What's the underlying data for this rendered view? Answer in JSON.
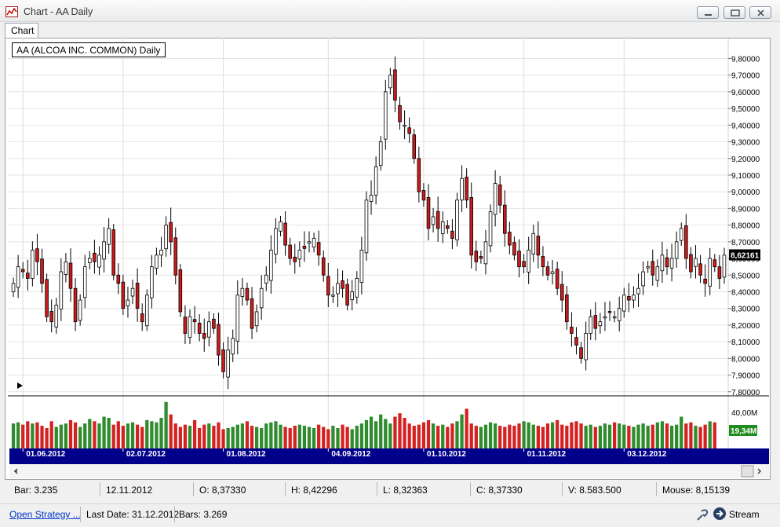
{
  "window": {
    "title": "Chart - AA Daily"
  },
  "tabs": [
    {
      "label": "Chart"
    }
  ],
  "legend": {
    "label": "AA (ALCOA INC. COMMON) Daily"
  },
  "current_price": "8,62161",
  "current_volume": "19,34M",
  "chart_data": {
    "type": "candlestick",
    "symbol": "AA (ALCOA INC. COMMON) Daily",
    "y_tick_labels": [
      "9,80000",
      "9,70000",
      "9,60000",
      "9,50000",
      "9,40000",
      "9,30000",
      "9,20000",
      "9,10000",
      "9,00000",
      "8,90000",
      "8,80000",
      "8,70000",
      "8,60000",
      "8,50000",
      "8,40000",
      "8,30000",
      "8,20000",
      "8,10000",
      "8,00000",
      "7,90000",
      "7,80000"
    ],
    "ylim": [
      7.78,
      9.84
    ],
    "volume_tick_label": "40,00M",
    "x_tick_labels": [
      "01.06.2012",
      "02.07.2012",
      "01.08.2012",
      "04.09.2012",
      "01.10.2012",
      "01.11.2012",
      "03.12.2012"
    ],
    "grid": true,
    "close": [
      8.45,
      8.55,
      8.52,
      8.48,
      8.65,
      8.58,
      8.45,
      8.25,
      8.22,
      8.32,
      8.52,
      8.58,
      8.42,
      8.22,
      8.35,
      8.55,
      8.6,
      8.58,
      8.62,
      8.7,
      8.78,
      8.5,
      8.45,
      8.3,
      8.35,
      8.42,
      8.3,
      8.22,
      8.38,
      8.55,
      8.62,
      8.65,
      8.8,
      8.7,
      8.5,
      8.28,
      8.15,
      8.25,
      8.22,
      8.15,
      8.12,
      8.22,
      8.18,
      8.02,
      7.92,
      8.05,
      8.12,
      8.38,
      8.42,
      8.35,
      8.18,
      8.28,
      8.42,
      8.5,
      8.65,
      8.78,
      8.82,
      8.68,
      8.6,
      8.58,
      8.65,
      8.66,
      8.7,
      8.72,
      8.62,
      8.5,
      8.38,
      8.38,
      8.45,
      8.42,
      8.32,
      8.4,
      8.48,
      8.65,
      8.95,
      8.98,
      9.15,
      9.3,
      9.6,
      9.7,
      9.55,
      9.42,
      9.4,
      9.35,
      9.2,
      9.0,
      8.95,
      8.78,
      8.85,
      8.78,
      8.82,
      8.78,
      8.72,
      8.95,
      9.08,
      8.95,
      8.62,
      8.58,
      8.6,
      8.7,
      8.88,
      9.05,
      8.92,
      8.75,
      8.68,
      8.62,
      8.55,
      8.55,
      8.65,
      8.75,
      8.62,
      8.55,
      8.5,
      8.52,
      8.42,
      8.35,
      8.22,
      8.15,
      8.08,
      8.0,
      8.15,
      8.25,
      8.18,
      8.22,
      8.25,
      8.28,
      8.25,
      8.3,
      8.38,
      8.35,
      8.38,
      8.42,
      8.52,
      8.55,
      8.5,
      8.55,
      8.62,
      8.55,
      8.6,
      8.7,
      8.78,
      8.6,
      8.52,
      8.6,
      8.5,
      8.45,
      8.6,
      8.55,
      8.48,
      8.62
    ],
    "volume_millions": [
      22,
      23,
      21,
      24,
      22,
      23,
      20,
      18,
      24,
      19,
      21,
      22,
      25,
      23,
      19,
      22,
      26,
      24,
      22,
      28,
      27,
      21,
      24,
      20,
      22,
      23,
      21,
      19,
      25,
      24,
      23,
      27,
      41,
      30,
      22,
      19,
      21,
      20,
      25,
      18,
      21,
      22,
      20,
      23,
      17,
      18,
      19,
      21,
      22,
      24,
      20,
      19,
      18,
      22,
      23,
      24,
      21,
      19,
      18,
      20,
      21,
      20,
      19,
      18,
      21,
      19,
      17,
      20,
      18,
      21,
      19,
      17,
      20,
      22,
      25,
      28,
      24,
      30,
      26,
      22,
      28,
      31,
      27,
      22,
      20,
      21,
      23,
      25,
      22,
      20,
      21,
      19,
      22,
      24,
      30,
      35,
      22,
      20,
      19,
      21,
      23,
      22,
      20,
      19,
      21,
      20,
      22,
      24,
      23,
      21,
      20,
      19,
      22,
      23,
      25,
      21,
      20,
      23,
      24,
      22,
      20,
      21,
      19,
      20,
      22,
      21,
      23,
      22,
      21,
      20,
      19,
      21,
      22,
      20,
      21,
      23,
      24,
      22,
      20,
      21,
      28,
      22,
      23,
      20,
      19,
      21,
      24,
      23
    ]
  },
  "status": {
    "bar": "Bar: 3.235",
    "date": "12.11.2012",
    "open": "O: 8,37330",
    "high": "H: 8,42296",
    "low": "L: 8,32363",
    "close": "C: 8,37330",
    "volume": "V: 8.583.500",
    "mouse": "Mouse: 8,15139"
  },
  "footer": {
    "open_strategy": "Open Strategy ...",
    "last_date": "Last Date: 31.12.2012",
    "bars": "Bars: 3.269",
    "stream": "Stream"
  },
  "colors": {
    "up": "#ffffff",
    "down": "#cc1b1b",
    "volume_up": "#2e8b2e",
    "volume_down": "#d42222",
    "timeline": "#00008b",
    "volume_badge": "#1e8c1e"
  }
}
